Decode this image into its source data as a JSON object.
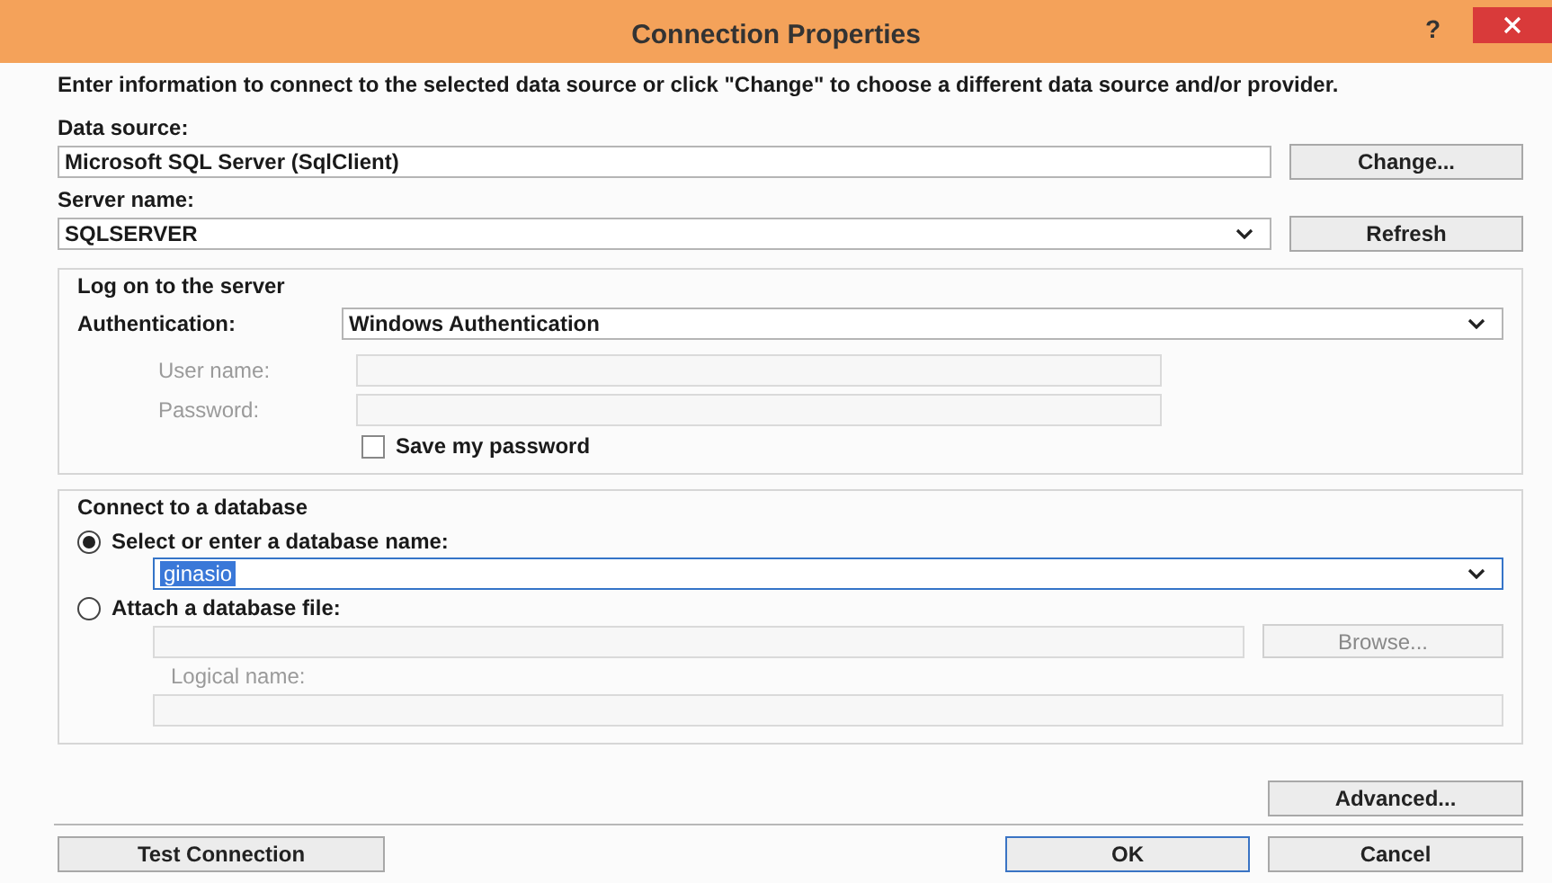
{
  "window": {
    "title": "Connection Properties",
    "help": "?"
  },
  "intro": "Enter information to connect to the selected data source or click \"Change\" to choose a different data source and/or provider.",
  "data_source": {
    "label": "Data source:",
    "value": "Microsoft SQL Server (SqlClient)",
    "button": "Change..."
  },
  "server_name": {
    "label": "Server name:",
    "value": "SQLSERVER",
    "button": "Refresh"
  },
  "log_on": {
    "title": "Log on to the server",
    "authentication": {
      "label": "Authentication:",
      "value": "Windows Authentication"
    },
    "user_name": {
      "label": "User name:",
      "disabled": true
    },
    "password": {
      "label": "Password:",
      "disabled": true
    },
    "save_password": {
      "label": "Save my password",
      "checked": false,
      "disabled": false
    }
  },
  "database": {
    "title": "Connect to a database",
    "options": [
      {
        "label": "Select or enter a database name:",
        "selected": true
      },
      {
        "label": "Attach a database file:",
        "selected": false
      }
    ],
    "database_name": {
      "value": "ginasio",
      "highlighted": true
    },
    "attach_file": {
      "button": "Browse...",
      "disabled": true
    },
    "logical_name": {
      "label": "Logical name:",
      "disabled": true
    }
  },
  "advanced_button": "Advanced...",
  "footer_buttons": [
    {
      "label": "Test Connection",
      "default": false
    },
    {
      "label": "OK",
      "default": true
    },
    {
      "label": "Cancel",
      "default": false
    }
  ]
}
